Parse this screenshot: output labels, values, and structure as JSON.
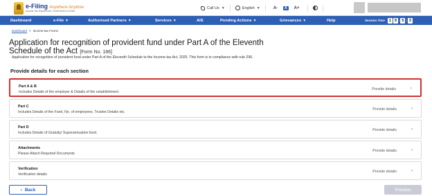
{
  "header": {
    "logo_title": "e-Filing",
    "logo_tagline": "Anywhere Anytime",
    "logo_subtitle": "Income Tax Department, Government of India",
    "call_us": "Call Us",
    "language": "English",
    "font_small": "A-",
    "font_normal": "A",
    "font_large": "A+"
  },
  "nav": {
    "items": [
      "Dashboard",
      "e-File",
      "Authorised Partners",
      "Services",
      "AIS",
      "Pending Actions",
      "Grievances",
      "Help"
    ],
    "session_label": "Session Time",
    "session_digits": [
      "1",
      "9",
      "5",
      "3"
    ]
  },
  "breadcrumb": {
    "home": "Dashboard",
    "current": "Income-tax Forms"
  },
  "page": {
    "title": "Application for recognition of provident fund under Part A of the Eleventh Schedule of the Act",
    "form_no": "[Form No. 186]",
    "description": "Application for recognition of provident fund under Part A of the Eleventh Schedule to the Income-tax Act, 2025. This form is in compliance with rule 296.",
    "section_heading": "Provide details for each section"
  },
  "sections": [
    {
      "title": "Part A & B",
      "subtitle": "Includes Details of the employer & Details of the establishment.",
      "link": "Provide details"
    },
    {
      "title": "Part C",
      "subtitle": "Includes Details of the Fund, No. of employees, Trustee Details etc.",
      "link": "Provide details"
    },
    {
      "title": "Part D",
      "subtitle": "Includes Details of Gratuity/ Superannuation fund.",
      "link": "Provide details"
    },
    {
      "title": "Attachments",
      "subtitle": "Please Attach Required Documents",
      "link": "Provide details"
    },
    {
      "title": "Verification",
      "subtitle": "Verification details",
      "link": "Provide details"
    }
  ],
  "footer": {
    "back": "Back",
    "preview": "Preview"
  },
  "colors": {
    "primary": "#2d5fb5",
    "highlight": "#d32f2f",
    "disabled": "#c9ccd6"
  }
}
